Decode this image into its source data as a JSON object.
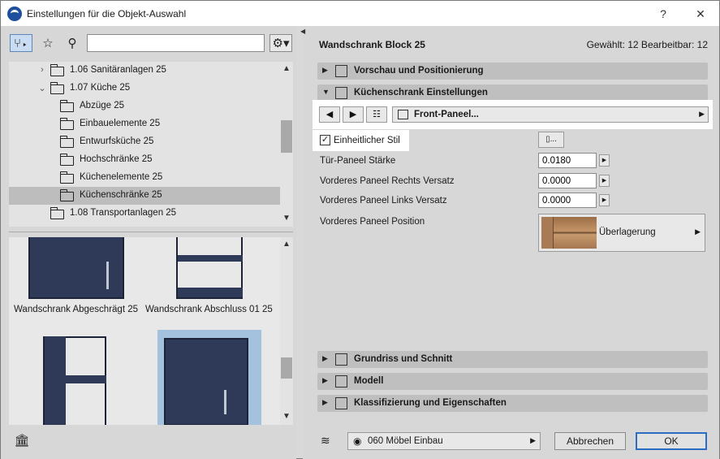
{
  "window": {
    "title": "Einstellungen für die Objekt-Auswahl",
    "help_label": "?",
    "close_label": "✕"
  },
  "left": {
    "search": {
      "value": "",
      "placeholder": ""
    },
    "tree": [
      {
        "label": "1.06 Sanitäranlagen 25",
        "expand": "›",
        "level": 1,
        "selected": false
      },
      {
        "label": "1.07 Küche 25",
        "expand": "⌄",
        "level": 1,
        "selected": false
      },
      {
        "label": "Abzüge 25",
        "expand": "",
        "level": 2,
        "selected": false
      },
      {
        "label": "Einbauelemente 25",
        "expand": "",
        "level": 2,
        "selected": false
      },
      {
        "label": "Entwurfsküche 25",
        "expand": "",
        "level": 2,
        "selected": false
      },
      {
        "label": "Hochschränke 25",
        "expand": "",
        "level": 2,
        "selected": false
      },
      {
        "label": "Küchenelemente 25",
        "expand": "",
        "level": 2,
        "selected": false
      },
      {
        "label": "Küchenschränke 25",
        "expand": "",
        "level": 2,
        "selected": true
      },
      {
        "label": "1.08 Transportanlagen 25",
        "expand": "",
        "level": 1,
        "selected": false
      }
    ],
    "thumbnails": [
      {
        "label": "Wandschrank Abgeschrägt 25",
        "selected": false
      },
      {
        "label": "Wandschrank Abschluss 01 25",
        "selected": false
      },
      {
        "label": "",
        "selected": false
      },
      {
        "label": "",
        "selected": true
      }
    ]
  },
  "right": {
    "object_name": "Wandschrank Block 25",
    "selection_info": "Gewählt: 12 Bearbeitbar: 12",
    "sections": {
      "preview": "Vorschau und Positionierung",
      "cabinet": "Küchenschrank Einstellungen",
      "floorplan": "Grundriss und Schnitt",
      "model": "Modell",
      "classification": "Klassifizierung und Eigenschaften"
    },
    "front_panel_label": "Front-Paneel...",
    "uniform_style_label": "Einheitlicher Stil",
    "uniform_style_checked": true,
    "uniform_style_btn": "...",
    "props": [
      {
        "label": "Tür-Paneel Stärke",
        "value": "0.0180"
      },
      {
        "label": "Vorderes Paneel Rechts Versatz",
        "value": "0.0000"
      },
      {
        "label": "Vorderes Paneel Links Versatz",
        "value": "0.0000"
      }
    ],
    "position_label": "Vorderes Paneel Position",
    "position_value": "Überlagerung",
    "layer_value": "060 Möbel Einbau",
    "cancel_label": "Abbrechen",
    "ok_label": "OK"
  },
  "colors": {
    "accent": "#2b6dc2",
    "selection": "#bdbdbd",
    "cabinet": "#2e3a57"
  }
}
